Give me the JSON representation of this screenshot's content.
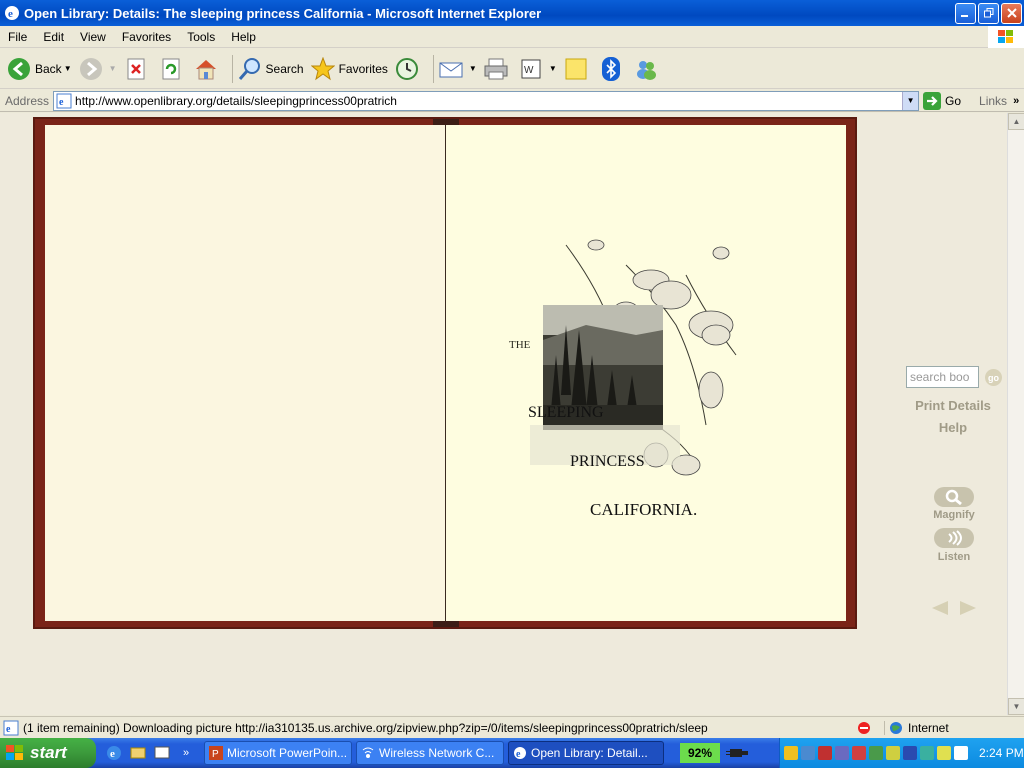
{
  "window": {
    "title": "Open Library: Details: The sleeping princess California - Microsoft Internet Explorer"
  },
  "menu": [
    "File",
    "Edit",
    "View",
    "Favorites",
    "Tools",
    "Help"
  ],
  "toolbar": {
    "back": "Back",
    "search": "Search",
    "favorites": "Favorites"
  },
  "address": {
    "label": "Address",
    "url": "http://www.openlibrary.org/details/sleepingprincess00pratrich",
    "go": "Go",
    "links": "Links"
  },
  "book": {
    "title_line1": "THE",
    "title_line2": "SLEEPING",
    "title_line3": "PRINCESS",
    "title_line4": "CALIFORNIA."
  },
  "side": {
    "search_placeholder": "search boo",
    "go": "go",
    "print_details": "Print Details",
    "help": "Help",
    "magnify": "Magnify",
    "listen": "Listen"
  },
  "status": {
    "message": "(1 item remaining) Downloading picture http://ia310135.us.archive.org/zipview.php?zip=/0/items/sleepingprincess00pratrich/sleep",
    "zone": "Internet"
  },
  "taskbar": {
    "start": "start",
    "tasks": [
      "Microsoft PowerPoin...",
      "Wireless Network C...",
      "Open Library: Detail..."
    ],
    "battery": "92%",
    "clock": "2:24 PM"
  },
  "colors": {
    "book_border": "#7a2418",
    "page": "#fefde0",
    "xp_blue": "#245edb"
  }
}
